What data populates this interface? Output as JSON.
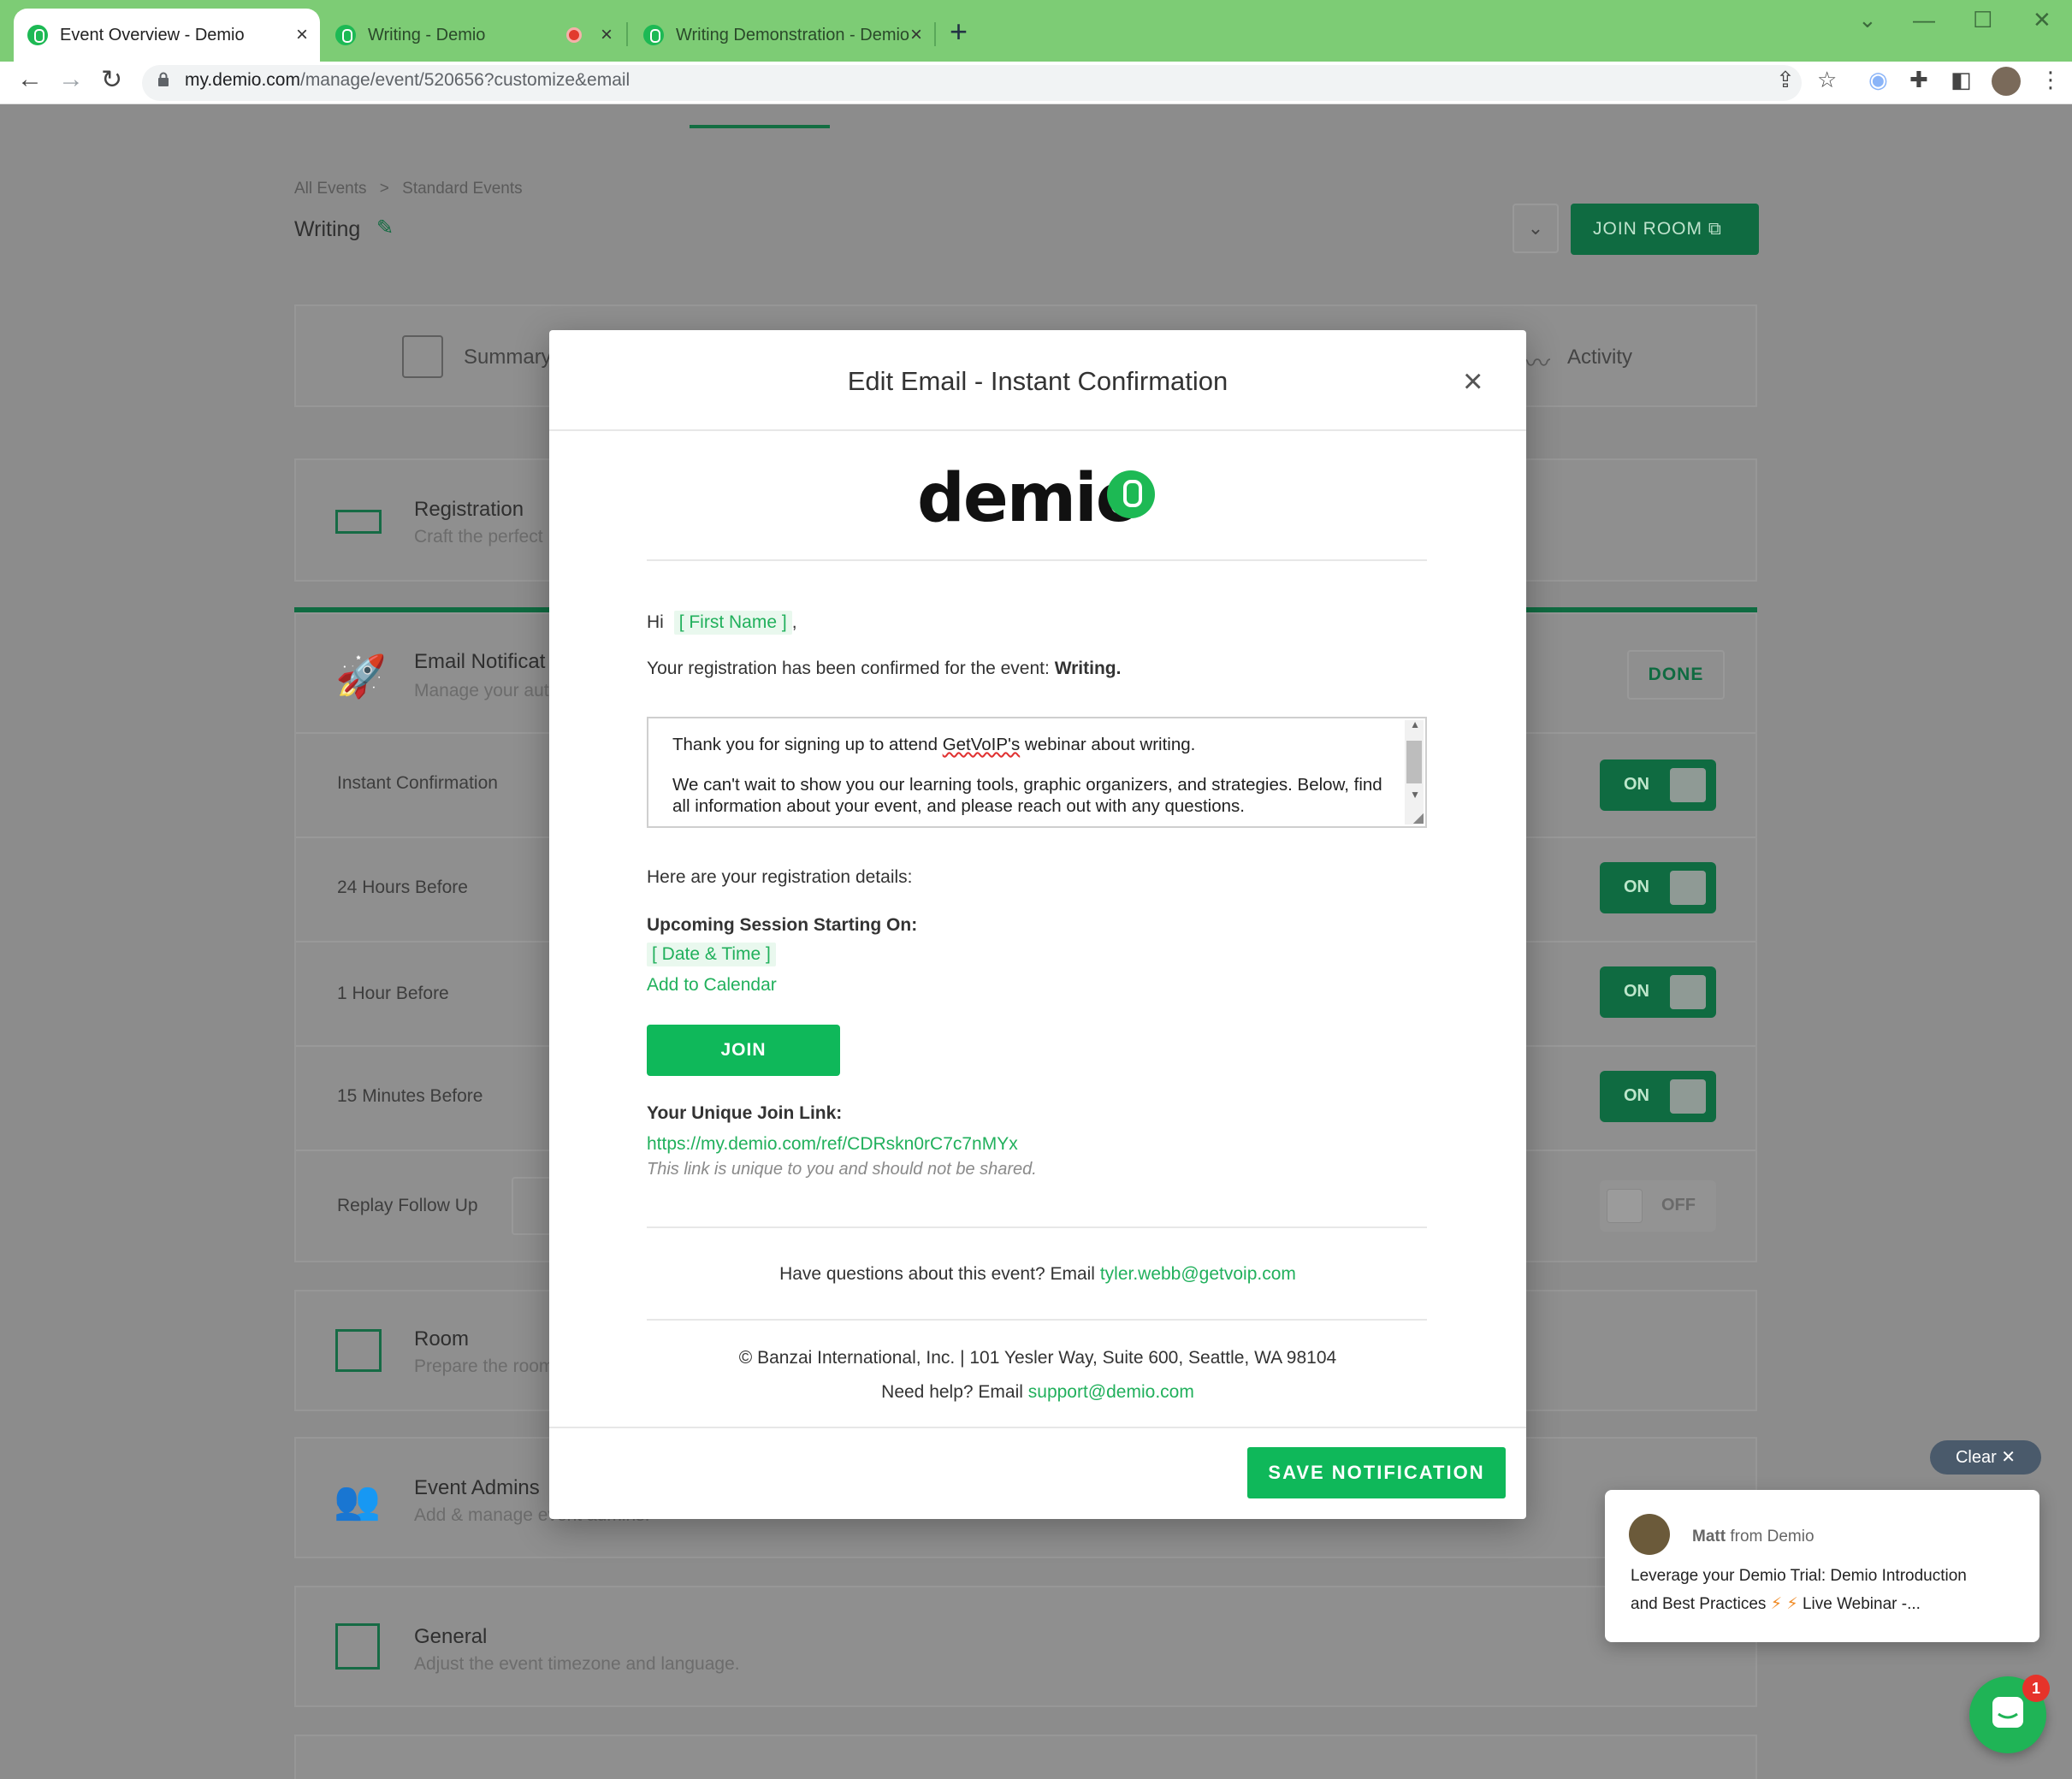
{
  "browser": {
    "tabs": [
      {
        "label": "Event Overview - Demio",
        "active": true
      },
      {
        "label": "Writing - Demio",
        "recording": true
      },
      {
        "label": "Writing Demonstration - Demio"
      }
    ],
    "url_host": "my.demio.com",
    "url_path": "/manage/event/520656?customize&email"
  },
  "header": {
    "breadcrumb_all": "All Events",
    "breadcrumb_sep": ">",
    "breadcrumb_type": "Standard Events",
    "event_title": "Writing",
    "join_room": "JOIN ROOM"
  },
  "tabs": {
    "summary": "Summary",
    "activity": "Activity"
  },
  "sections": {
    "registration_title": "Registration",
    "registration_sub": "Craft the perfect",
    "email_title": "Email Notificat",
    "email_sub": "Manage your aut",
    "done": "DONE",
    "room_title": "Room",
    "room_sub": "Prepare the room",
    "admins_title": "Event Admins",
    "admins_sub": "Add & manage event admins.",
    "general_title": "General",
    "general_sub": "Adjust the event timezone and language."
  },
  "notifications": [
    {
      "label": "Instant Confirmation",
      "state": "ON"
    },
    {
      "label": "24 Hours Before",
      "state": "ON"
    },
    {
      "label": "1 Hour Before",
      "state": "ON"
    },
    {
      "label": "15 Minutes Before",
      "state": "ON"
    },
    {
      "label": "Replay Follow Up",
      "state": "OFF"
    }
  ],
  "modal": {
    "title": "Edit Email - Instant Confirmation",
    "logo_text": "demio",
    "greeting_hi": "Hi",
    "first_name_token": "[ First Name ]",
    "greeting_comma": ",",
    "confirmed_text": "Your registration has been confirmed for the event:",
    "event_name": "Writing.",
    "body_line1_pre": "Thank you for signing up to attend",
    "body_line1_brand": "GetVoIP's",
    "body_line1_post": "webinar about writing.",
    "body_line2": "We can't wait to show you our learning tools, graphic organizers, and strategies. Below, find all information about your event, and please reach out with any questions.",
    "details_intro": "Here are your registration details:",
    "session_heading": "Upcoming Session Starting On:",
    "date_token": "[ Date & Time ]",
    "add_calendar": "Add to Calendar",
    "join_label": "JOIN",
    "join_link_heading": "Your Unique Join Link:",
    "join_link": "https://my.demio.com/ref/CDRskn0rC7c7nMYx",
    "join_link_note": "This link is unique to you and should not be shared.",
    "questions_text": "Have questions about this event? Email",
    "questions_email": "tyler.webb@getvoip.com",
    "footer_address": "© Banzai International, Inc. | 101 Yesler Way, Suite 600, Seattle, WA 98104",
    "help_text": "Need help? Email",
    "help_email": "support@demio.com",
    "save_label": "SAVE NOTIFICATION"
  },
  "chat": {
    "clear_label": "Clear",
    "sender_name": "Matt",
    "sender_from": "from Demio",
    "message_line1": "Leverage your Demio Trial: Demio Introduction",
    "message_line2_pre": "and Best Practices",
    "message_line2_post": "Live Webinar -...",
    "badge_count": "1"
  },
  "colors": {
    "brand_green": "#0fb85a",
    "token_green": "#21b05c",
    "tab_bar": "#7dcc75"
  }
}
